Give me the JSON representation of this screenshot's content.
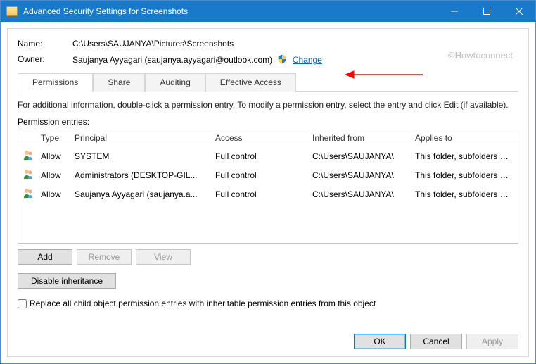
{
  "window": {
    "title": "Advanced Security Settings for Screenshots"
  },
  "watermark": "©Howtoconnect",
  "name_label": "Name:",
  "name_value": "C:\\Users\\SAUJANYA\\Pictures\\Screenshots",
  "owner_label": "Owner:",
  "owner_value": "Saujanya Ayyagari (saujanya.ayyagari@outlook.com)",
  "change_link": "Change",
  "tabs": {
    "permissions": "Permissions",
    "share": "Share",
    "auditing": "Auditing",
    "effective": "Effective Access"
  },
  "help_text": "For additional information, double-click a permission entry. To modify a permission entry, select the entry and click Edit (if available).",
  "entries_label": "Permission entries:",
  "columns": {
    "type": "Type",
    "principal": "Principal",
    "access": "Access",
    "inherited": "Inherited from",
    "applies": "Applies to"
  },
  "entries": [
    {
      "type": "Allow",
      "principal": "SYSTEM",
      "access": "Full control",
      "inherited": "C:\\Users\\SAUJANYA\\",
      "applies": "This folder, subfolders and files"
    },
    {
      "type": "Allow",
      "principal": "Administrators (DESKTOP-GIL...",
      "access": "Full control",
      "inherited": "C:\\Users\\SAUJANYA\\",
      "applies": "This folder, subfolders and files"
    },
    {
      "type": "Allow",
      "principal": "Saujanya Ayyagari (saujanya.a...",
      "access": "Full control",
      "inherited": "C:\\Users\\SAUJANYA\\",
      "applies": "This folder, subfolders and files"
    }
  ],
  "buttons": {
    "add": "Add",
    "remove": "Remove",
    "view": "View",
    "disable_inh": "Disable inheritance",
    "ok": "OK",
    "cancel": "Cancel",
    "apply": "Apply"
  },
  "checkbox_label": "Replace all child object permission entries with inheritable permission entries from this object"
}
